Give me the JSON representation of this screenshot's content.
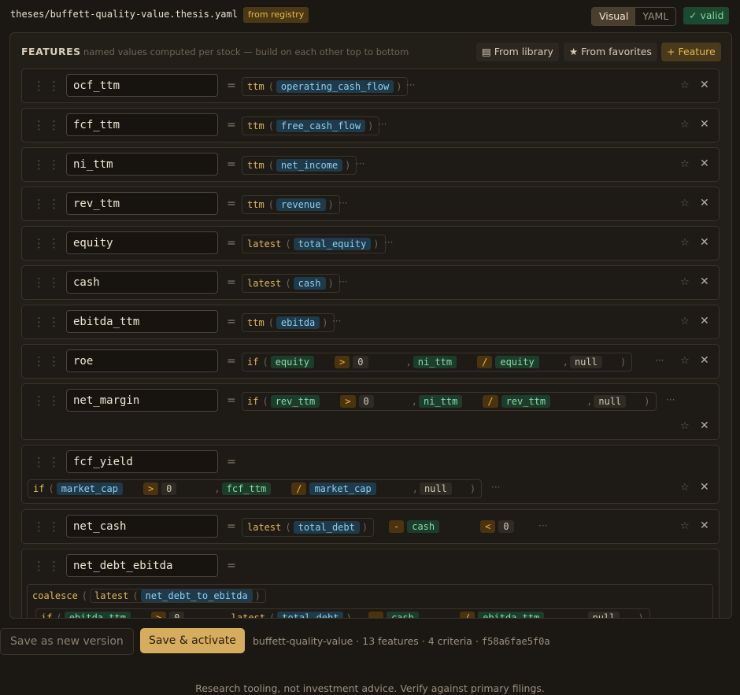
{
  "header": {
    "path": "theses/buffett-quality-value.thesis.yaml",
    "registry_badge": "from registry",
    "view_tabs": [
      "Visual",
      "YAML"
    ],
    "active_view": "Visual",
    "valid_badge": "✓ valid"
  },
  "features_panel": {
    "title": "FEATURES",
    "subtitle": "named values computed per stock — build on each other top to bottom",
    "buttons": {
      "library": "▤ From library",
      "favorites": "★ From favorites",
      "add": "+ Feature"
    },
    "rows": [
      {
        "name": "ocf_ttm",
        "expr": {
          "fn": "ttm",
          "args": [
            "operating_cash_flow"
          ]
        }
      },
      {
        "name": "fcf_ttm",
        "expr": {
          "fn": "ttm",
          "args": [
            "free_cash_flow"
          ]
        }
      },
      {
        "name": "ni_ttm",
        "expr": {
          "fn": "ttm",
          "args": [
            "net_income"
          ]
        }
      },
      {
        "name": "rev_ttm",
        "expr": {
          "fn": "ttm",
          "args": [
            "revenue"
          ]
        }
      },
      {
        "name": "equity",
        "expr": {
          "fn": "latest",
          "args": [
            "total_equity"
          ]
        }
      },
      {
        "name": "cash",
        "expr": {
          "fn": "latest",
          "args": [
            "cash"
          ]
        }
      },
      {
        "name": "ebitda_ttm",
        "expr": {
          "fn": "ttm",
          "args": [
            "ebitda"
          ]
        }
      },
      {
        "name": "roe",
        "expr": {
          "fn": "if",
          "cond": [
            "equity",
            ">",
            "0"
          ],
          "then": [
            "ni_ttm",
            "/",
            "equity"
          ],
          "else": "null"
        }
      },
      {
        "name": "net_margin",
        "expr": {
          "fn": "if",
          "cond": [
            "rev_ttm",
            ">",
            "0"
          ],
          "then": [
            "ni_ttm",
            "/",
            "rev_ttm"
          ],
          "else": "null"
        }
      },
      {
        "name": "fcf_yield",
        "expr": {
          "fn": "if",
          "cond": [
            "market_cap",
            ">",
            "0"
          ],
          "then": [
            "fcf_ttm",
            "/",
            "market_cap"
          ],
          "else": "null"
        }
      },
      {
        "name": "net_cash",
        "expr": {
          "fn": "latest",
          "args": [
            "total_debt"
          ],
          "op": "-",
          "rhs": "cash",
          "cmp": "<",
          "cmp_value": "0"
        }
      },
      {
        "name": "net_debt_ebitda",
        "expr": {
          "fn": "coalesce",
          "first": {
            "fn": "latest",
            "args": [
              "net_debt_to_ebitda"
            ]
          },
          "second": {
            "fn": "if",
            "cond": [
              "ebitda_ttm",
              ">",
              "0"
            ],
            "then_fn": "latest",
            "then_arg": "total_debt",
            "then_op": "-",
            "then_rhs": "cash",
            "div": "/",
            "div_rhs": "ebitda_ttm",
            "else": "null"
          }
        }
      }
    ],
    "equals": "=",
    "ellipsis": "···",
    "star": "☆",
    "remove": "✕"
  },
  "bottom_bar": {
    "save_new": "Save as new version",
    "save_activate": "Save & activate",
    "status_text": "buffett-quality-value · 13 features · 4 criteria · ",
    "hash": "f58a6fae5f0a"
  },
  "footer": "Research tooling, not investment advice. Verify against primary filings.",
  "colors": {
    "accent": "#d6ac5e",
    "valid": "#7bd69a",
    "ref": "#8fd0f0",
    "var": "#86dca4",
    "op": "#f0b048"
  }
}
